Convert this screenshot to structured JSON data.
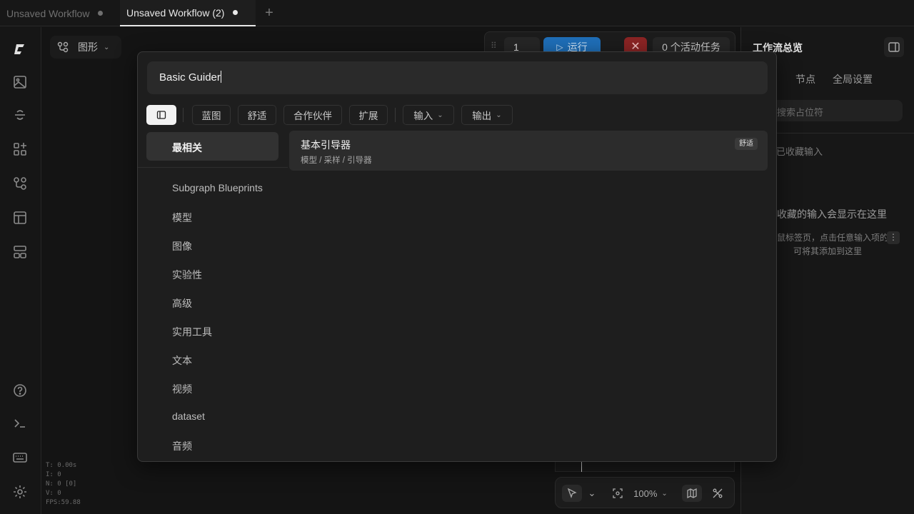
{
  "tabs": [
    {
      "label": "Unsaved Workflow"
    },
    {
      "label": "Unsaved Workflow (2)"
    }
  ],
  "canvas": {
    "graph_mode": "图形",
    "stats": [
      "T: 0.00s",
      "I: 0",
      "N: 0 [0]",
      "V: 0",
      "FPS:59.88"
    ]
  },
  "runbar": {
    "count": "1",
    "run_label": "运行",
    "cancel_label": "✕",
    "tasks_label": "0 个活动任务"
  },
  "right_panel": {
    "title": "工作流总览",
    "tabs": [
      "节点",
      "全局设置"
    ],
    "search_placeholder": "搜索占位符",
    "section_label": "已收藏输入",
    "empty_title": "收藏的输入会显示在这里",
    "empty_desc_line1": "鼠标签页，点击任意输入项的",
    "empty_desc_line2": "可将其添加到这里"
  },
  "bottom_toolbar": {
    "zoom": "100%"
  },
  "dialog": {
    "search_value": "Basic Guider",
    "filters": {
      "blueprint": "蓝图",
      "comfy": "舒适",
      "partner": "合作伙伴",
      "extension": "扩展",
      "input": "输入",
      "output": "输出"
    },
    "active_category": "最相关",
    "categories": [
      "Subgraph Blueprints",
      "模型",
      "图像",
      "实验性",
      "高级",
      "实用工具",
      "文本",
      "视频",
      "dataset",
      "音频"
    ],
    "results": [
      {
        "title": "基本引导器",
        "path": "模型 / 采样 / 引导器",
        "badge": "舒适"
      }
    ]
  },
  "colors": {
    "accent_run": "#1f6fb9",
    "cancel": "#8b2424",
    "background": "#141414"
  }
}
